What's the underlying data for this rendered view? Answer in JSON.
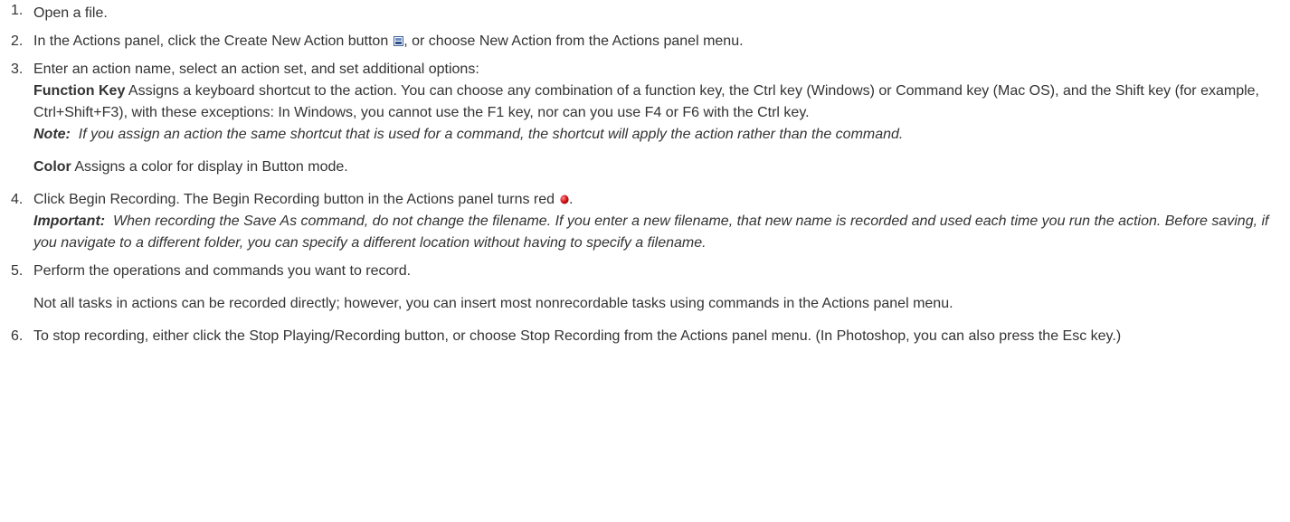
{
  "steps": [
    {
      "num": "1.",
      "text": "Open a file."
    },
    {
      "num": "2.",
      "text_before_icon": "In the Actions panel, click the Create New Action button",
      "icon": "new-action-icon",
      "text_after_icon": ", or choose New Action from the Actions panel menu."
    },
    {
      "num": "3.",
      "intro": "Enter an action name, select an action set, and set additional options:",
      "function_key": {
        "term": "Function Key",
        "desc": "Assigns a keyboard shortcut to the action. You can choose any combination of a function key, the Ctrl key (Windows) or Command key (Mac OS), and the Shift key (for example, Ctrl+Shift+F3), with these exceptions: In Windows, you cannot use the F1 key, nor can you use F4 or F6 with the Ctrl key."
      },
      "note": {
        "label": "Note:",
        "text": "If you assign an action the same shortcut that is used for a command, the shortcut will apply the action rather than the command."
      },
      "color": {
        "term": "Color",
        "desc": "Assigns a color for display in Button mode."
      }
    },
    {
      "num": "4.",
      "text_before_icon": "Click Begin Recording. The Begin Recording button in the Actions panel turns red",
      "icon": "record-icon",
      "text_after_icon": ".",
      "important": {
        "label": "Important:",
        "text": "When recording the Save As command, do not change the filename. If you enter a new filename, that new name is recorded and used each time you run the action. Before saving, if you navigate to a different folder, you can specify a different location without having to specify a filename."
      }
    },
    {
      "num": "5.",
      "text": "Perform the operations and commands you want to record.",
      "extra": "Not all tasks in actions can be recorded directly; however, you can insert most nonrecordable tasks using commands in the Actions panel menu."
    },
    {
      "num": "6.",
      "text": "To stop recording, either click the Stop Playing/Recording button, or choose Stop Recording from the Actions panel menu. (In Photoshop, you can also press the Esc key.)"
    }
  ],
  "colors": {
    "text": "#333333",
    "record_red": "#d7141a",
    "icon_blue": "#3a5f9e"
  }
}
